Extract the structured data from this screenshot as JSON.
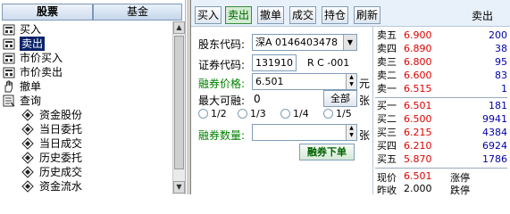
{
  "left_tabs": [
    "股票",
    "基金"
  ],
  "tree": {
    "items": [
      {
        "label": "买入",
        "icon": "buy-icon"
      },
      {
        "label": "卖出",
        "icon": "sell-icon",
        "selected": true
      },
      {
        "label": "市价买入",
        "icon": "market-buy-icon"
      },
      {
        "label": "市价卖出",
        "icon": "market-sell-icon"
      },
      {
        "label": "撤单",
        "icon": "hand-icon"
      },
      {
        "label": "查询",
        "icon": "query-icon"
      }
    ],
    "query_children": [
      "资金股份",
      "当日委托",
      "当日成交",
      "历史委托",
      "历史成交",
      "资金流水"
    ]
  },
  "toolbar": {
    "buttons": [
      "买入",
      "卖出",
      "撤单",
      "成交",
      "持仓",
      "刷新"
    ],
    "active": "卖出",
    "title": "卖出"
  },
  "form": {
    "account_label": "股东代码:",
    "account_value": "深A 0146403478",
    "code_label": "证券代码:",
    "code_value": "131910",
    "code_name": "R C -001",
    "price_label": "融券价格:",
    "price_value": "6.501",
    "price_unit": "元",
    "max_label": "最大可融:",
    "max_value": "0",
    "all_button": "全部",
    "max_unit": "张",
    "ratios": [
      "1/2",
      "1/3",
      "1/4",
      "1/5"
    ],
    "qty_label": "融券数量:",
    "qty_value": "",
    "qty_unit": "张",
    "submit": "融券下单"
  },
  "quote": {
    "sell": [
      {
        "label": "卖五",
        "price": "6.900",
        "vol": "200"
      },
      {
        "label": "卖四",
        "price": "6.890",
        "vol": "38"
      },
      {
        "label": "卖三",
        "price": "6.800",
        "vol": "95"
      },
      {
        "label": "卖二",
        "price": "6.600",
        "vol": "83"
      },
      {
        "label": "卖一",
        "price": "6.515",
        "vol": "1"
      }
    ],
    "buy": [
      {
        "label": "买一",
        "price": "6.501",
        "vol": "181"
      },
      {
        "label": "买二",
        "price": "6.500",
        "vol": "9941"
      },
      {
        "label": "买三",
        "price": "6.215",
        "vol": "4384"
      },
      {
        "label": "买四",
        "price": "6.210",
        "vol": "6924"
      },
      {
        "label": "买五",
        "price": "5.870",
        "vol": "1786"
      }
    ],
    "current_label": "现价",
    "current_value": "6.501",
    "limit_up_label": "涨停",
    "prev_close_label": "昨收",
    "prev_close_value": "2.000",
    "limit_down_label": "跌停"
  },
  "colors": {
    "accent_green": "#008000",
    "price_red": "#e00000",
    "vol_blue": "#0000aa",
    "selection": "#0a246a"
  }
}
